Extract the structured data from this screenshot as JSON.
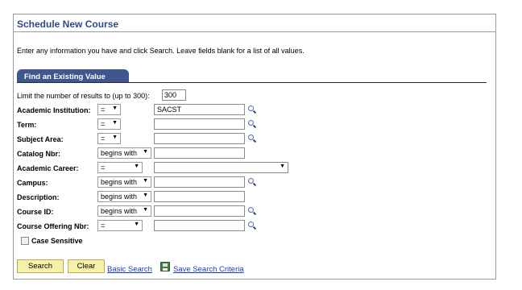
{
  "header": {
    "title": "Schedule New Course",
    "instructions": "Enter any information you have and click Search. Leave fields blank for a list of all values."
  },
  "tab": {
    "label": "Find an Existing Value"
  },
  "limit": {
    "label": "Limit the number of results to (up to 300):",
    "value": "300"
  },
  "fields": {
    "institution": {
      "label": "Academic Institution:",
      "operator": "=",
      "value": "SACST"
    },
    "term": {
      "label": "Term:",
      "operator": "=",
      "value": ""
    },
    "subject": {
      "label": "Subject Area:",
      "operator": "=",
      "value": ""
    },
    "catalog": {
      "label": "Catalog Nbr:",
      "operator": "begins with",
      "value": ""
    },
    "career": {
      "label": "Academic Career:",
      "operator": "=",
      "value": ""
    },
    "campus": {
      "label": "Campus:",
      "operator": "begins with",
      "value": ""
    },
    "description": {
      "label": "Description:",
      "operator": "begins with",
      "value": ""
    },
    "course_id": {
      "label": "Course ID:",
      "operator": "begins with",
      "value": ""
    },
    "offering": {
      "label": "Course Offering Nbr:",
      "operator": "=",
      "value": ""
    }
  },
  "case_sensitive": {
    "label": "Case Sensitive",
    "checked": false
  },
  "buttons": {
    "search": "Search",
    "clear": "Clear",
    "basic_search": "Basic Search",
    "save_criteria": "Save Search Criteria"
  },
  "icons": {
    "lookup": "magnifier-icon",
    "save": "floppy-disk-icon",
    "dropdown": "chevron-down-icon"
  },
  "colors": {
    "title": "#2c4a8a",
    "tab_bg": "#3f568f",
    "button_bg": "#f6f0a8",
    "link": "#1a3bb8"
  }
}
